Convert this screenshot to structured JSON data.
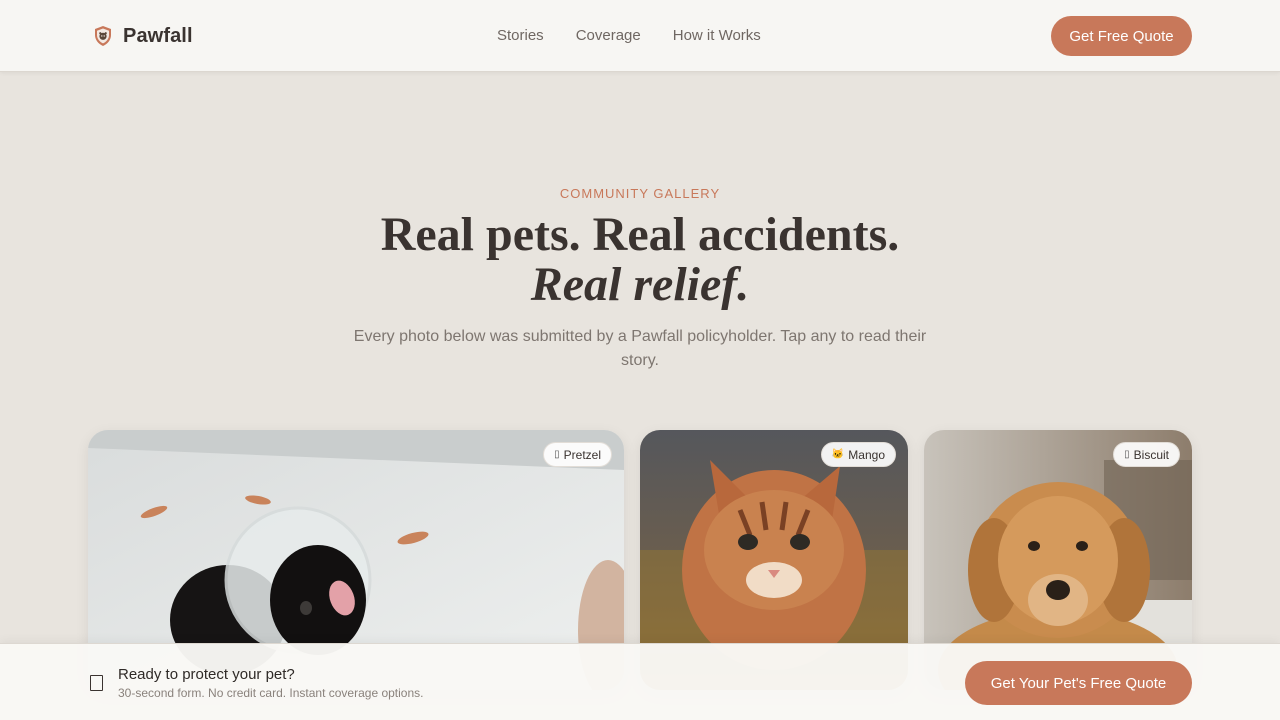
{
  "header": {
    "brand": "Pawfall",
    "nav": [
      "Stories",
      "Coverage",
      "How it Works"
    ],
    "cta": "Get Free Quote"
  },
  "hero": {
    "eyebrow": "COMMUNITY GALLERY",
    "headline_line1": "Real pets. Real accidents.",
    "headline_line2": "Real relief.",
    "subtitle": "Every photo below was submitted by a Pawfall policyholder. Tap any to read their story."
  },
  "gallery": [
    {
      "name": "Pretzel",
      "icon": "dog-icon"
    },
    {
      "name": "Mango",
      "icon": "cat-icon"
    },
    {
      "name": "Biscuit",
      "icon": "dog-icon"
    }
  ],
  "bottom_bar": {
    "title": "Ready to protect your pet?",
    "subtitle": "30-second form. No credit card. Instant coverage options.",
    "cta": "Get Your Pet's Free Quote"
  },
  "colors": {
    "accent": "#c8785a",
    "background": "#e8e4de",
    "text": "#3a3330"
  }
}
